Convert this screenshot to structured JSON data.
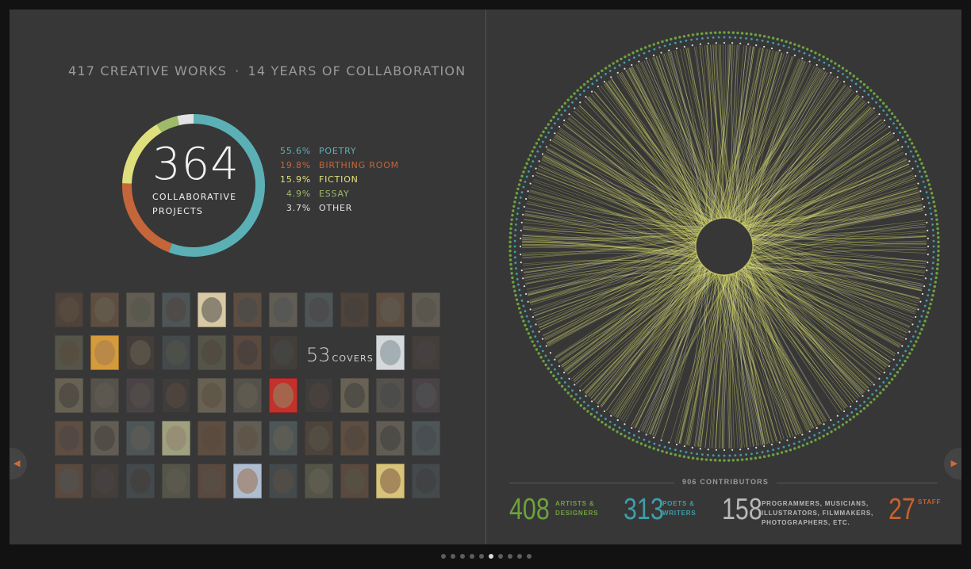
{
  "headline": {
    "works": "417 CREATIVE WORKS",
    "separator": "·",
    "years": "14 YEARS OF COLLABORATION"
  },
  "projects": {
    "count": "364",
    "label_line1": "COLLABORATIVE",
    "label_line2": "PROJECTS"
  },
  "covers": {
    "count": "53",
    "word": "COVERS"
  },
  "contributors": {
    "title": "906 CONTRIBUTORS",
    "groups": [
      {
        "value": "408",
        "label_line1": "ARTISTS &",
        "label_line2": "DESIGNERS",
        "label_line3": "",
        "color": "#6ea33e"
      },
      {
        "value": "313",
        "label_line1": "POETS &",
        "label_line2": "WRITERS",
        "label_line3": "",
        "color": "#3e9eab"
      },
      {
        "value": "158",
        "label_line1": "PROGRAMMERS, MUSICIANS,",
        "label_line2": "ILLUSTRATORS, FILMMAKERS,",
        "label_line3": "PHOTOGRAPHERS, ETC.",
        "color": "#b8b8b8"
      },
      {
        "value": "27",
        "label_line1": "STAFF",
        "label_line2": "",
        "label_line3": "",
        "color": "#c9622f"
      }
    ]
  },
  "navigation": {
    "prev_icon": "prev-arrow-icon",
    "next_icon": "next-arrow-icon",
    "page_count": 10,
    "active_page": 5
  },
  "chart_data": [
    {
      "type": "pie",
      "variant": "donut",
      "categories": [
        "POETRY",
        "BIRTHING ROOM",
        "FICTION",
        "ESSAY",
        "OTHER"
      ],
      "values": [
        55.6,
        19.8,
        15.9,
        4.9,
        3.7
      ],
      "value_labels": [
        "55.6%",
        "19.8%",
        "15.9%",
        "4.9%",
        "3.7%"
      ],
      "colors": [
        "#5bb0b6",
        "#c4663a",
        "#dfe07d",
        "#9fba69",
        "#e2e2e2"
      ],
      "center_value": "364",
      "legend_placement": "right"
    },
    {
      "type": "network",
      "layout": "circular",
      "rings": [
        {
          "group": "artists-designers",
          "color": "#6ea33e"
        },
        {
          "group": "poets-writers",
          "color": "#3e9eab"
        },
        {
          "group": "other-contributors",
          "color": "#dddddd"
        }
      ],
      "edge_color": "#dfe06f",
      "secondary_edge_color": "#dddddd"
    }
  ]
}
